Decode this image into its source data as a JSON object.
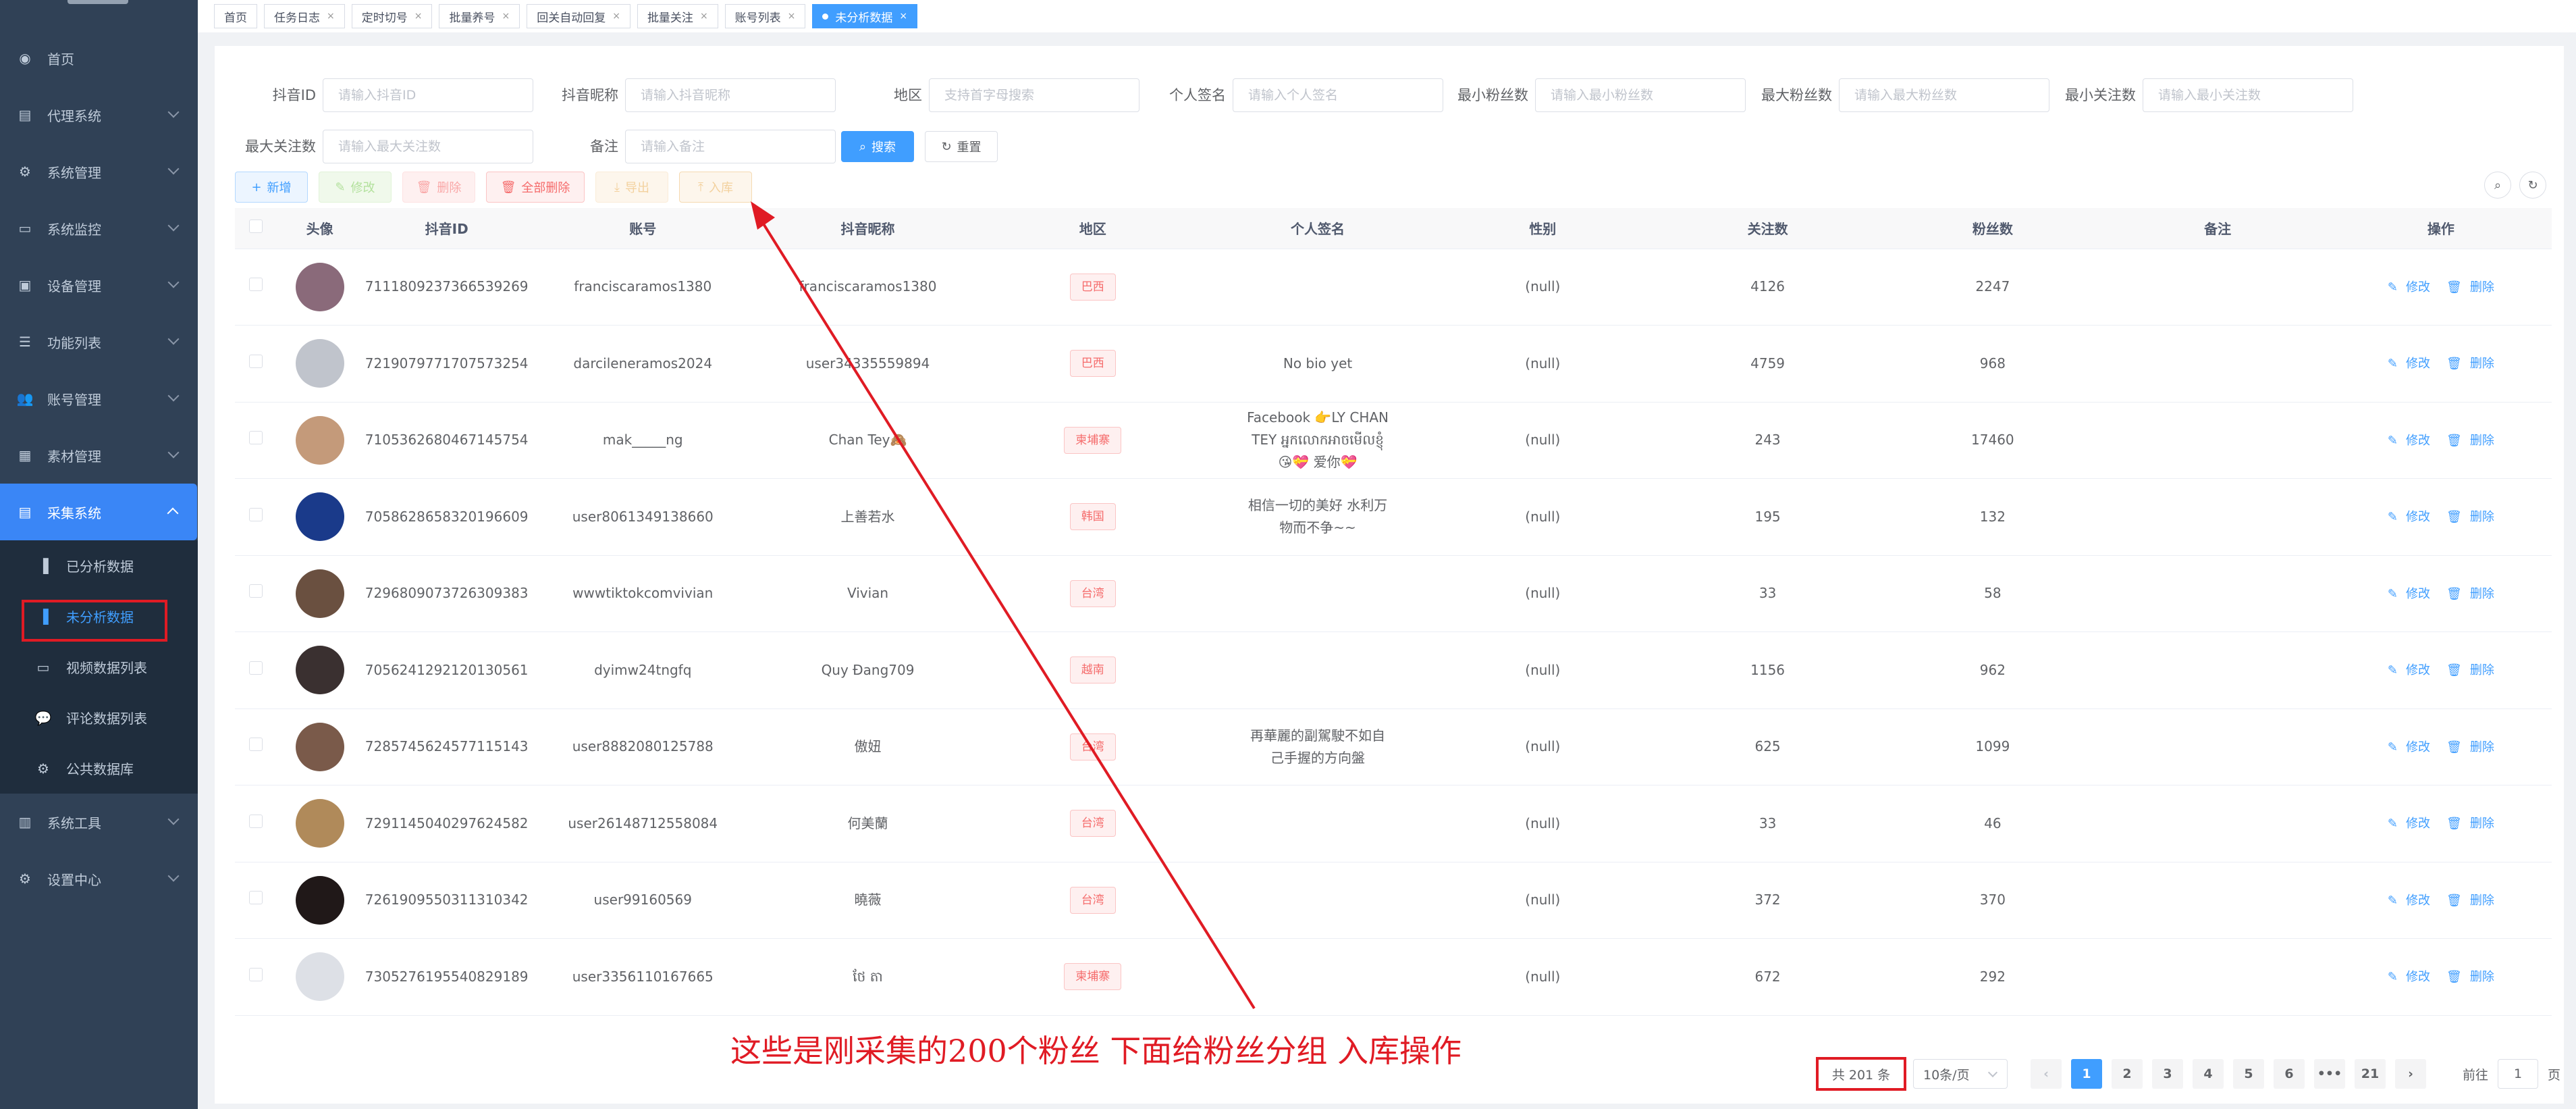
{
  "sidebar": {
    "items": [
      {
        "label": "首页",
        "icon": "dashboard-icon"
      },
      {
        "label": "代理系统",
        "icon": "document-icon"
      },
      {
        "label": "系统管理",
        "icon": "gear-icon"
      },
      {
        "label": "系统监控",
        "icon": "monitor-icon"
      },
      {
        "label": "设备管理",
        "icon": "device-icon"
      },
      {
        "label": "功能列表",
        "icon": "list-icon"
      },
      {
        "label": "账号管理",
        "icon": "user-icon"
      },
      {
        "label": "素材管理",
        "icon": "folder-icon"
      },
      {
        "label": "采集系统",
        "icon": "collect-icon"
      },
      {
        "label": "系统工具",
        "icon": "tool-icon"
      },
      {
        "label": "设置中心",
        "icon": "settings-icon"
      }
    ],
    "sub_items": [
      {
        "label": "已分析数据",
        "icon": "bar-chart-icon"
      },
      {
        "label": "未分析数据",
        "icon": "bar-chart-icon"
      },
      {
        "label": "视频数据列表",
        "icon": "video-icon"
      },
      {
        "label": "评论数据列表",
        "icon": "comment-icon"
      },
      {
        "label": "公共数据库",
        "icon": "gear-icon"
      }
    ]
  },
  "tabs": [
    "首页",
    "任务日志",
    "定时切号",
    "批量养号",
    "回关自动回复",
    "批量关注",
    "账号列表",
    "未分析数据"
  ],
  "filters": {
    "douyin_id": {
      "label": "抖音ID",
      "placeholder": "请输入抖音ID"
    },
    "nickname": {
      "label": "抖音昵称",
      "placeholder": "请输入抖音昵称"
    },
    "region": {
      "label": "地区",
      "placeholder": "支持首字母搜索"
    },
    "signature": {
      "label": "个人签名",
      "placeholder": "请输入个人签名"
    },
    "min_fans": {
      "label": "最小粉丝数",
      "placeholder": "请输入最小粉丝数"
    },
    "max_fans": {
      "label": "最大粉丝数",
      "placeholder": "请输入最大粉丝数"
    },
    "min_follow": {
      "label": "最小关注数",
      "placeholder": "请输入最小关注数"
    },
    "max_follow": {
      "label": "最大关注数",
      "placeholder": "请输入最大关注数"
    },
    "remark": {
      "label": "备注",
      "placeholder": "请输入备注"
    },
    "search_label": "搜索",
    "reset_label": "重置"
  },
  "toolbar": {
    "add": "新增",
    "edit": "修改",
    "delete": "删除",
    "delete_all": "全部删除",
    "export": "导出",
    "import": "入库"
  },
  "table": {
    "headers": [
      "头像",
      "抖音ID",
      "账号",
      "抖音昵称",
      "地区",
      "个人签名",
      "性别",
      "关注数",
      "粉丝数",
      "备注",
      "操作"
    ],
    "edit_label": "修改",
    "delete_label": "删除",
    "rows": [
      {
        "id": "7111809237366539269",
        "account": "franciscaramos1380",
        "nick": "franciscaramos1380",
        "region": "巴西",
        "sign": "",
        "gender": "(null)",
        "follow": "4126",
        "fans": "2247",
        "remark": "",
        "avatar": "#8a6a7a"
      },
      {
        "id": "7219079771707573254",
        "account": "darcileneramos2024",
        "nick": "user34335559894",
        "region": "巴西",
        "sign": "No bio yet",
        "gender": "(null)",
        "follow": "4759",
        "fans": "968",
        "remark": "",
        "avatar": "#c0c4cc"
      },
      {
        "id": "7105362680467145754",
        "account": "mak_____ng",
        "nick": "Chan Tey🙈",
        "region": "柬埔寨",
        "sign": "Facebook 👉LY CHAN TEY អ្នកលោកអាចមើលខ្ញុំ😘💝 爱你💝",
        "gender": "(null)",
        "follow": "243",
        "fans": "17460",
        "remark": "",
        "avatar": "#c49a7a"
      },
      {
        "id": "7058628658320196609",
        "account": "user8061349138660",
        "nick": "上善若水",
        "region": "韩国",
        "sign": "相信一切的美好 水利万物而不争~~",
        "gender": "(null)",
        "follow": "195",
        "fans": "132",
        "remark": "",
        "avatar": "#1a3a8a"
      },
      {
        "id": "7296809073726309383",
        "account": "wwwtiktokcomvivian",
        "nick": "Vivian",
        "region": "台湾",
        "sign": "",
        "gender": "(null)",
        "follow": "33",
        "fans": "58",
        "remark": "",
        "avatar": "#6a5040"
      },
      {
        "id": "7056241292120130561",
        "account": "dyimw24tngfq",
        "nick": "Quy Đang709",
        "region": "越南",
        "sign": "",
        "gender": "(null)",
        "follow": "1156",
        "fans": "962",
        "remark": "",
        "avatar": "#3a3030"
      },
      {
        "id": "7285745624577115143",
        "account": "user8882080125788",
        "nick": "傲妞",
        "region": "台湾",
        "sign": "再華麗的副駕駛不如自己手握的方向盤",
        "gender": "(null)",
        "follow": "625",
        "fans": "1099",
        "remark": "",
        "avatar": "#7a5a4a"
      },
      {
        "id": "7291145040297624582",
        "account": "user26148712558084",
        "nick": "何美蘭",
        "region": "台湾",
        "sign": "",
        "gender": "(null)",
        "follow": "33",
        "fans": "46",
        "remark": "",
        "avatar": "#b08a5a"
      },
      {
        "id": "7261909550311310342",
        "account": "user99160569",
        "nick": "曉薇",
        "region": "台湾",
        "sign": "",
        "gender": "(null)",
        "follow": "372",
        "fans": "370",
        "remark": "",
        "avatar": "#201818"
      },
      {
        "id": "7305276195540829189",
        "account": "user3356110167665",
        "nick": "ថែ តា",
        "region": "柬埔寨",
        "sign": "",
        "gender": "(null)",
        "follow": "672",
        "fans": "292",
        "remark": "",
        "avatar": "#dde0e6"
      }
    ]
  },
  "annotation": "这些是刚采集的200个粉丝     下面给粉丝分组 入库操作",
  "pagination": {
    "total": "共 201 条",
    "page_size": "10条/页",
    "pages": [
      "1",
      "2",
      "3",
      "4",
      "5",
      "6",
      "•••",
      "21"
    ],
    "current": "1",
    "goto_label": "前往",
    "goto_value": "1",
    "page_unit": "页"
  },
  "colors": {
    "sidebar_bg": "#304156",
    "accent": "#409eff",
    "annotation": "#e01b24"
  }
}
